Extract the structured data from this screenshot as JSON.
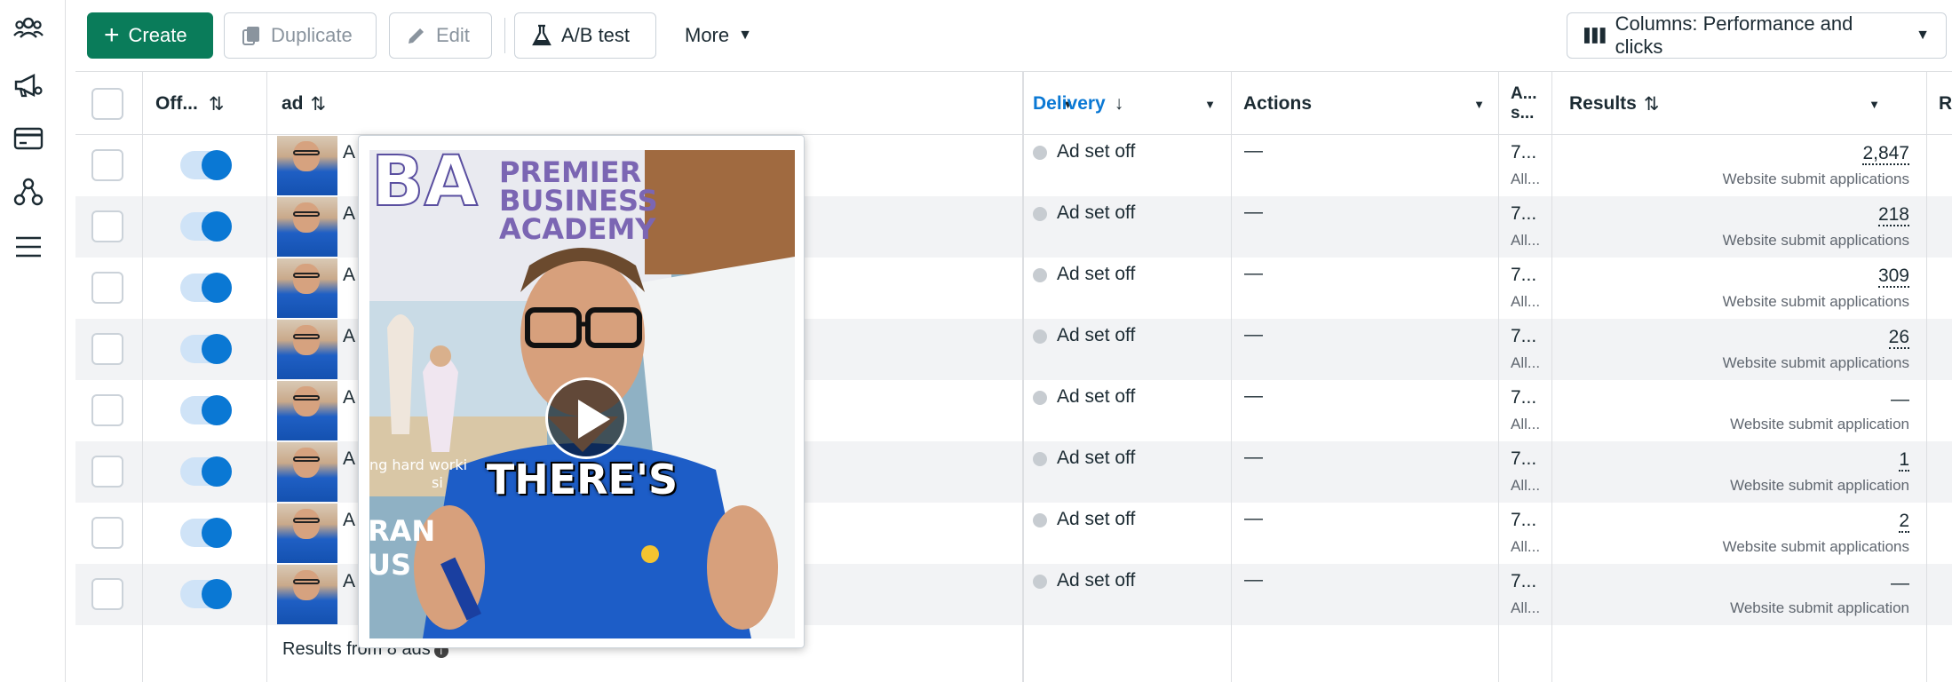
{
  "toolbar": {
    "create": "Create",
    "duplicate": "Duplicate",
    "edit": "Edit",
    "ab_test": "A/B test",
    "more": "More",
    "columns": "Columns: Performance and clicks"
  },
  "table": {
    "headers": {
      "onoff": "Off...",
      "ad": "ad",
      "delivery": "Delivery",
      "actions": "Actions",
      "attribution": "A... s...",
      "results": "Results",
      "next": "R"
    },
    "rows": [
      {
        "thumb_text": "A",
        "delivery": "Ad set off",
        "actions": "—",
        "attr1": "7...",
        "attr2": "All...",
        "result": "2,847",
        "result_label": "Website submit applications"
      },
      {
        "thumb_text": "A",
        "delivery": "Ad set off",
        "actions": "—",
        "attr1": "7...",
        "attr2": "All...",
        "result": "218",
        "result_label": "Website submit applications"
      },
      {
        "thumb_text": "A",
        "delivery": "Ad set off",
        "actions": "—",
        "attr1": "7...",
        "attr2": "All...",
        "result": "309",
        "result_label": "Website submit applications"
      },
      {
        "thumb_text": "A",
        "delivery": "Ad set off",
        "actions": "—",
        "attr1": "7...",
        "attr2": "All...",
        "result": "26",
        "result_label": "Website submit applications"
      },
      {
        "thumb_text": "A",
        "delivery": "Ad set off",
        "actions": "—",
        "attr1": "7...",
        "attr2": "All...",
        "result": "—",
        "result_label": "Website submit application"
      },
      {
        "thumb_text": "A",
        "delivery": "Ad set off",
        "actions": "—",
        "attr1": "7...",
        "attr2": "All...",
        "result": "1",
        "result_label": "Website submit application"
      },
      {
        "thumb_text": "A",
        "delivery": "Ad set off",
        "actions": "—",
        "attr1": "7...",
        "attr2": "All...",
        "result": "2",
        "result_label": "Website submit applications"
      },
      {
        "thumb_text": "A",
        "delivery": "Ad set off",
        "actions": "—",
        "attr1": "7...",
        "attr2": "All...",
        "result": "—",
        "result_label": "Website submit application"
      }
    ],
    "footer": "Results from 8 ads"
  },
  "preview": {
    "banner_logo": "BA",
    "banner_line1": "PREMIER",
    "banner_line2": "BUSINESS",
    "banner_line3": "ACADEMY",
    "caption": "THERE'S",
    "overlay_text": "ng hard worki",
    "overlay_text2": "si",
    "partial_left1": "RAN",
    "partial_left2": "US"
  },
  "colors": {
    "primary": "#0a7c5a",
    "toggle": "#0a78d4",
    "delivery_header": "#0a78d4"
  }
}
